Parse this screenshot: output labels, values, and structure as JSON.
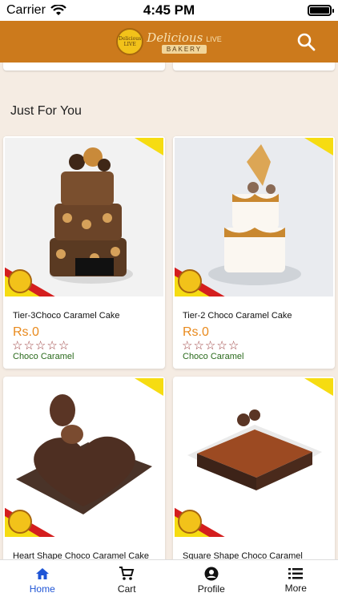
{
  "status_bar": {
    "carrier": "Carrier",
    "time": "4:45 PM"
  },
  "header": {
    "logo": {
      "title": "Delicious",
      "live": "LIVE",
      "bakery": "BAKERY"
    },
    "search_icon": "search-icon"
  },
  "section": {
    "title": "Just For You"
  },
  "products": [
    {
      "name": "Tier-3Choco Caramel Cake",
      "price": "Rs.0",
      "rating": 0,
      "flavor": "Choco Caramel"
    },
    {
      "name": "Tier-2 Choco Caramel Cake",
      "price": "Rs.0",
      "rating": 0,
      "flavor": "Choco Caramel"
    },
    {
      "name": "Heart Shape Choco Caramel Cake",
      "price": "",
      "rating": 0,
      "flavor": ""
    },
    {
      "name": "Square  Shape  Choco  Caramel",
      "price": "",
      "rating": 0,
      "flavor": ""
    }
  ],
  "tab_bar": {
    "items": [
      {
        "label": "Home",
        "icon": "home-icon",
        "active": true
      },
      {
        "label": "Cart",
        "icon": "cart-icon",
        "active": false
      },
      {
        "label": "Profile",
        "icon": "profile-icon",
        "active": false
      },
      {
        "label": "More",
        "icon": "menu-icon",
        "active": false
      }
    ]
  },
  "colors": {
    "header": "#cc7a1c",
    "accent": "#1f55d6",
    "price": "#e98a1d",
    "flavor": "#2a6a1c",
    "background": "#f5ece3"
  }
}
